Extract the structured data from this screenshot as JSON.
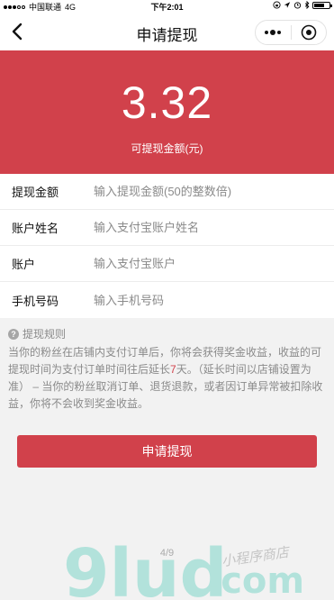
{
  "status_bar": {
    "carrier": "中国联通",
    "network": "4G",
    "time": "下午2:01",
    "battery_level": 0.7
  },
  "nav": {
    "title": "申请提现",
    "back_icon": "chevron-left-icon",
    "more_icon": "more-dots-icon",
    "close_icon": "target-close-icon"
  },
  "balance": {
    "amount": "3.32",
    "label": "可提现金额(元)"
  },
  "form": {
    "fields": [
      {
        "label": "提现金额",
        "placeholder": "输入提现金额(50的整数倍)"
      },
      {
        "label": "账户姓名",
        "placeholder": "输入支付宝账户姓名"
      },
      {
        "label": "账户",
        "placeholder": "输入支付宝账户"
      },
      {
        "label": "手机号码",
        "placeholder": "输入手机号码"
      }
    ]
  },
  "rules": {
    "title": "提现规则",
    "text_before": "当你的粉丝在店铺内支付订单后，你将会获得奖金收益，收益的可提现时间为支付订单时间往后延长",
    "days": "7",
    "text_after": "天。（延长时间以店铺设置为准） – 当你的粉丝取消订单、退货退款，或者因订单异常被扣除收益，你将不会收到奖金收益。"
  },
  "submit_label": "申请提现",
  "watermark": {
    "brand": "9lud",
    "domain": ".com",
    "slogan": "小程序商店"
  },
  "page_indicator": "4/9",
  "colors": {
    "accent": "#d1414b",
    "background": "#f2f2f2"
  }
}
